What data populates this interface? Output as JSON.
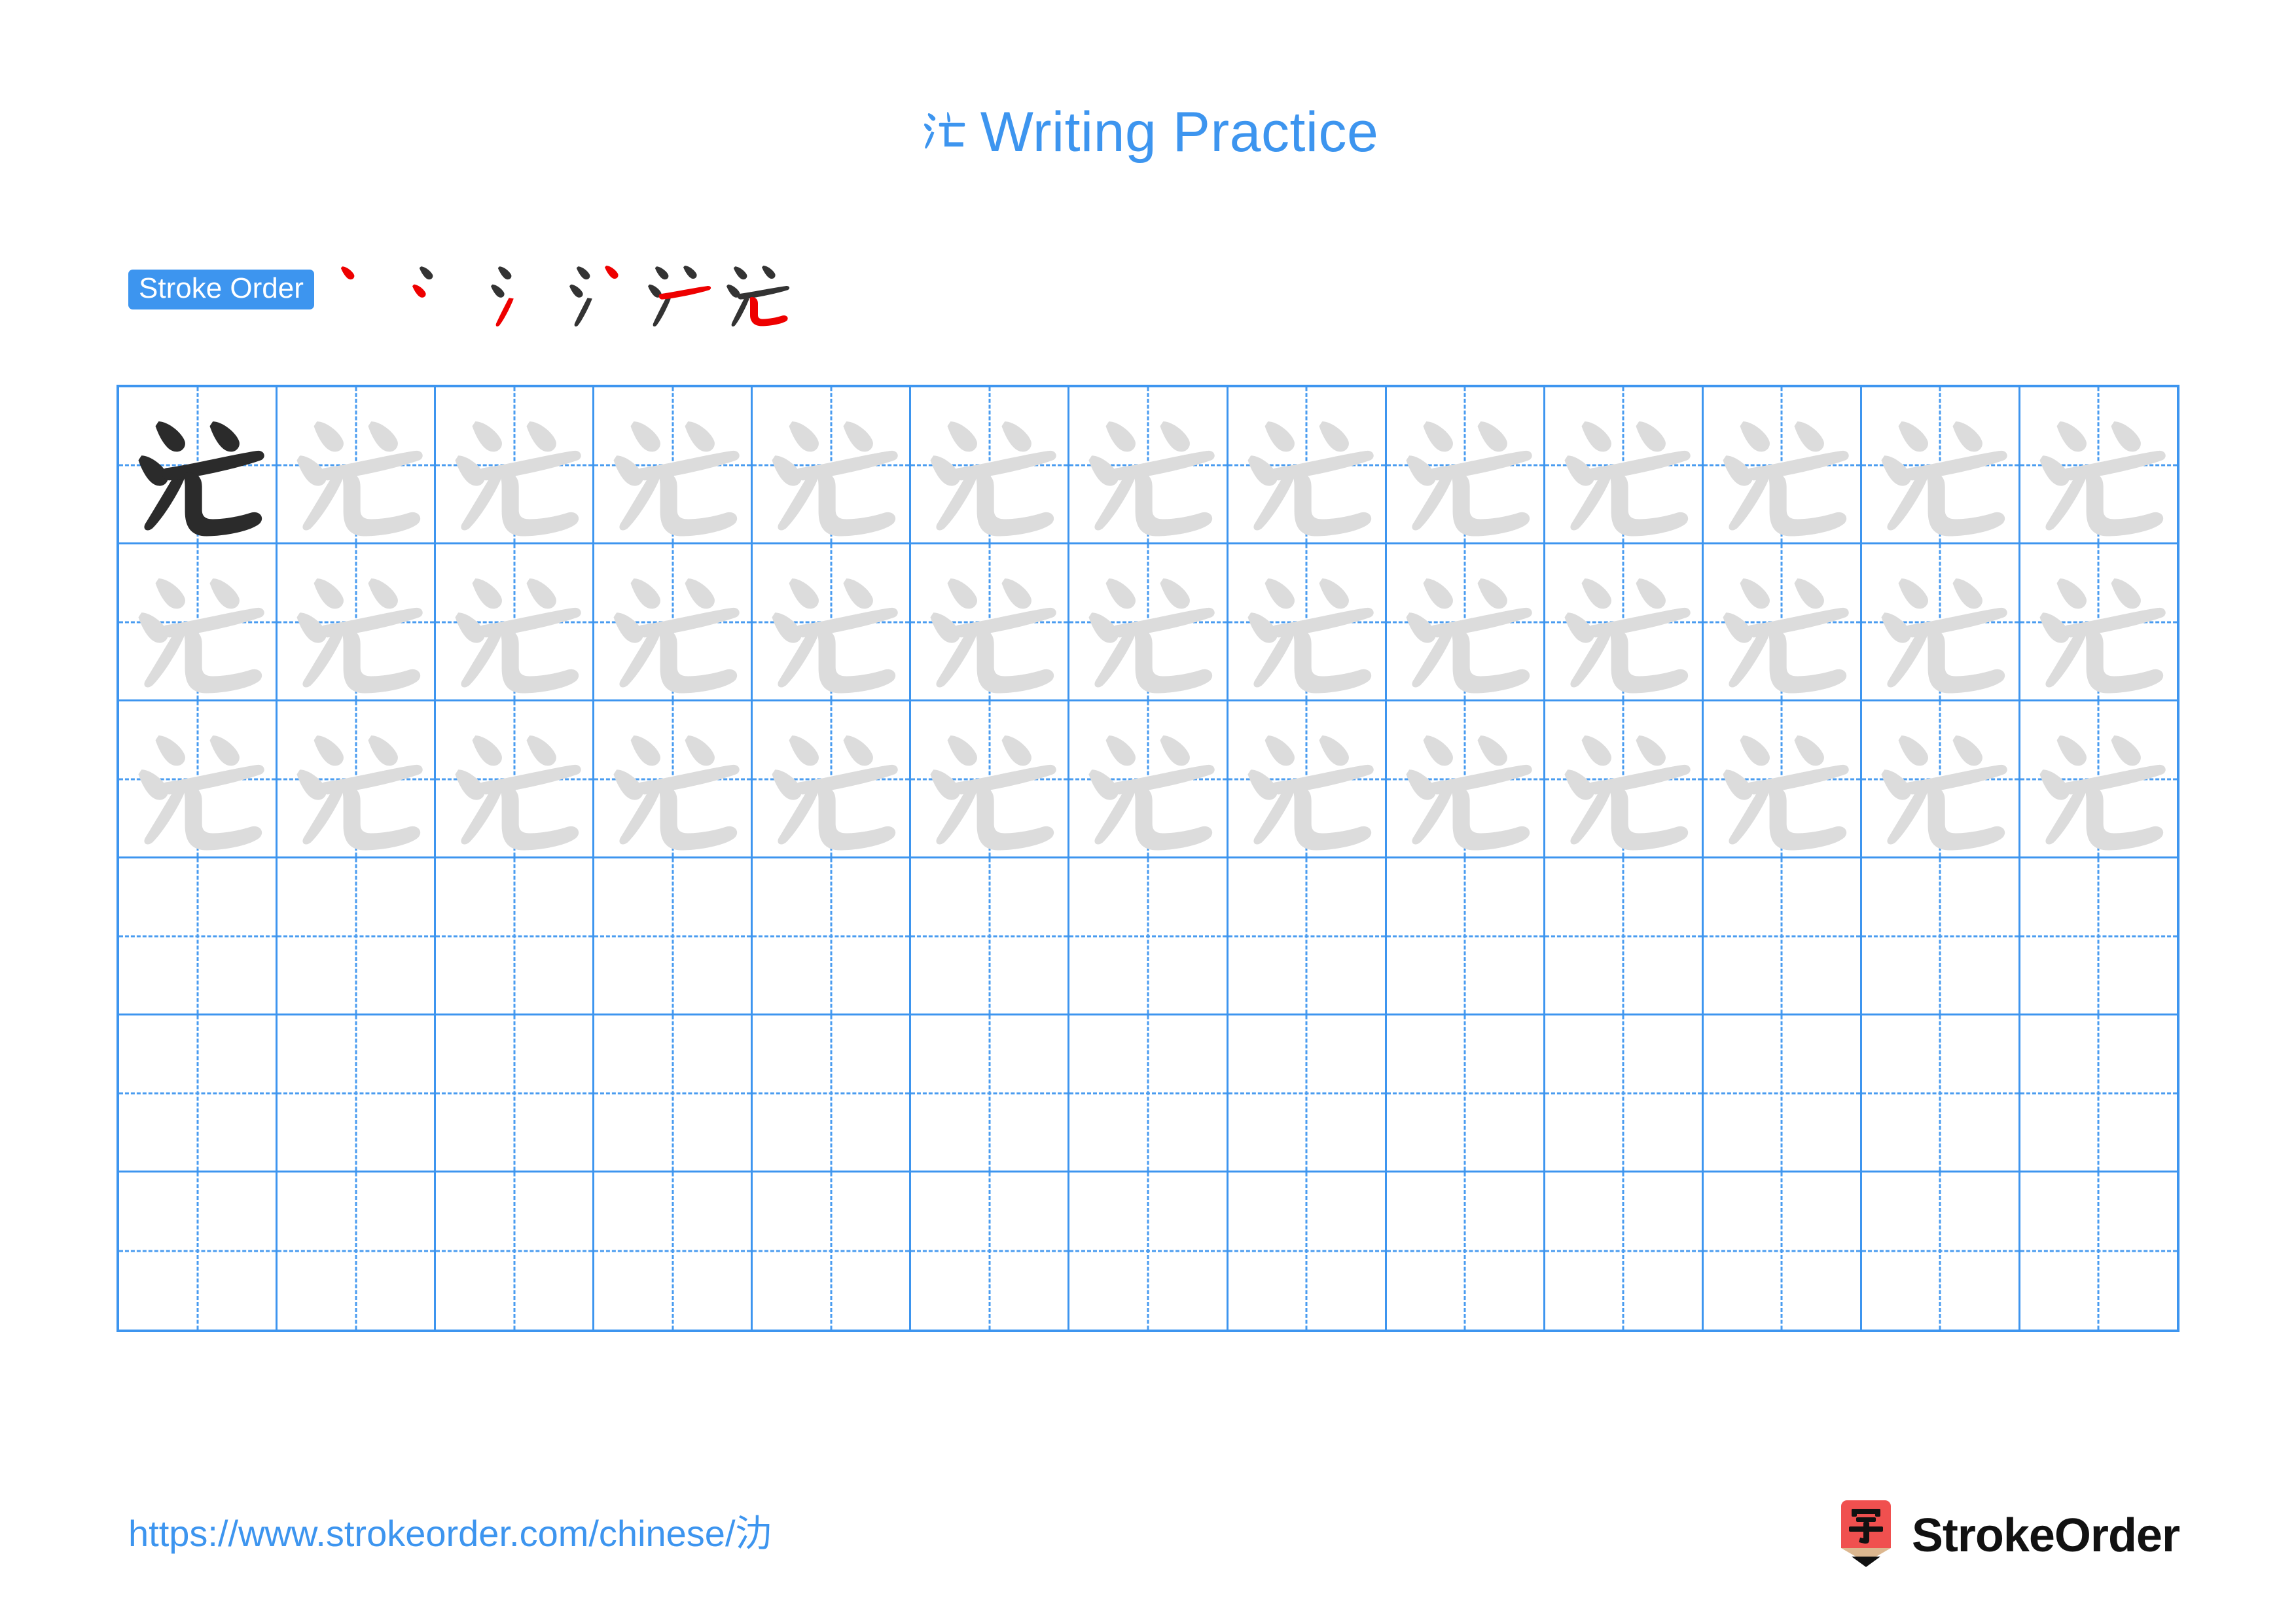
{
  "character": "氻",
  "title": {
    "character": "氻",
    "text": "Writing Practice",
    "color": "#3d95ef"
  },
  "stroke_order": {
    "badge_label": "Stroke Order",
    "badge_bg": "#3d95ef",
    "badge_text_color": "#ffffff",
    "total_strokes": 6,
    "ink_color": "#333333",
    "highlight_color": "#ee0000",
    "steps": [
      {
        "index": 1,
        "new_stroke": "dot-1",
        "strokes_shown": 1
      },
      {
        "index": 2,
        "new_stroke": "dot-2",
        "strokes_shown": 2
      },
      {
        "index": 3,
        "new_stroke": "flick-up",
        "strokes_shown": 3
      },
      {
        "index": 4,
        "new_stroke": "dot-top-right",
        "strokes_shown": 4
      },
      {
        "index": 5,
        "new_stroke": "horizontal",
        "strokes_shown": 5
      },
      {
        "index": 6,
        "new_stroke": "hook-bend",
        "strokes_shown": 6
      }
    ]
  },
  "grid": {
    "columns": 13,
    "rows": 6,
    "line_color": "#3d95ef",
    "guide_color": "#4a9cf0",
    "model_color": "#2b2b2b",
    "trace_color": "#dcdcdc",
    "cells": [
      [
        "model",
        "trace",
        "trace",
        "trace",
        "trace",
        "trace",
        "trace",
        "trace",
        "trace",
        "trace",
        "trace",
        "trace",
        "trace"
      ],
      [
        "trace",
        "trace",
        "trace",
        "trace",
        "trace",
        "trace",
        "trace",
        "trace",
        "trace",
        "trace",
        "trace",
        "trace",
        "trace"
      ],
      [
        "trace",
        "trace",
        "trace",
        "trace",
        "trace",
        "trace",
        "trace",
        "trace",
        "trace",
        "trace",
        "trace",
        "trace",
        "trace"
      ],
      [
        "empty",
        "empty",
        "empty",
        "empty",
        "empty",
        "empty",
        "empty",
        "empty",
        "empty",
        "empty",
        "empty",
        "empty",
        "empty"
      ],
      [
        "empty",
        "empty",
        "empty",
        "empty",
        "empty",
        "empty",
        "empty",
        "empty",
        "empty",
        "empty",
        "empty",
        "empty",
        "empty"
      ],
      [
        "empty",
        "empty",
        "empty",
        "empty",
        "empty",
        "empty",
        "empty",
        "empty",
        "empty",
        "empty",
        "empty",
        "empty",
        "empty"
      ]
    ]
  },
  "footer": {
    "url": "https://www.strokeorder.com/chinese/氻",
    "url_color": "#3d95ef",
    "brand_name": "StrokeOrder",
    "brand_mark_character": "字",
    "brand_mark_colors": {
      "body": "#f0504f",
      "wood": "#dcb78f",
      "tip": "#111111",
      "glyph": "#111111"
    }
  }
}
